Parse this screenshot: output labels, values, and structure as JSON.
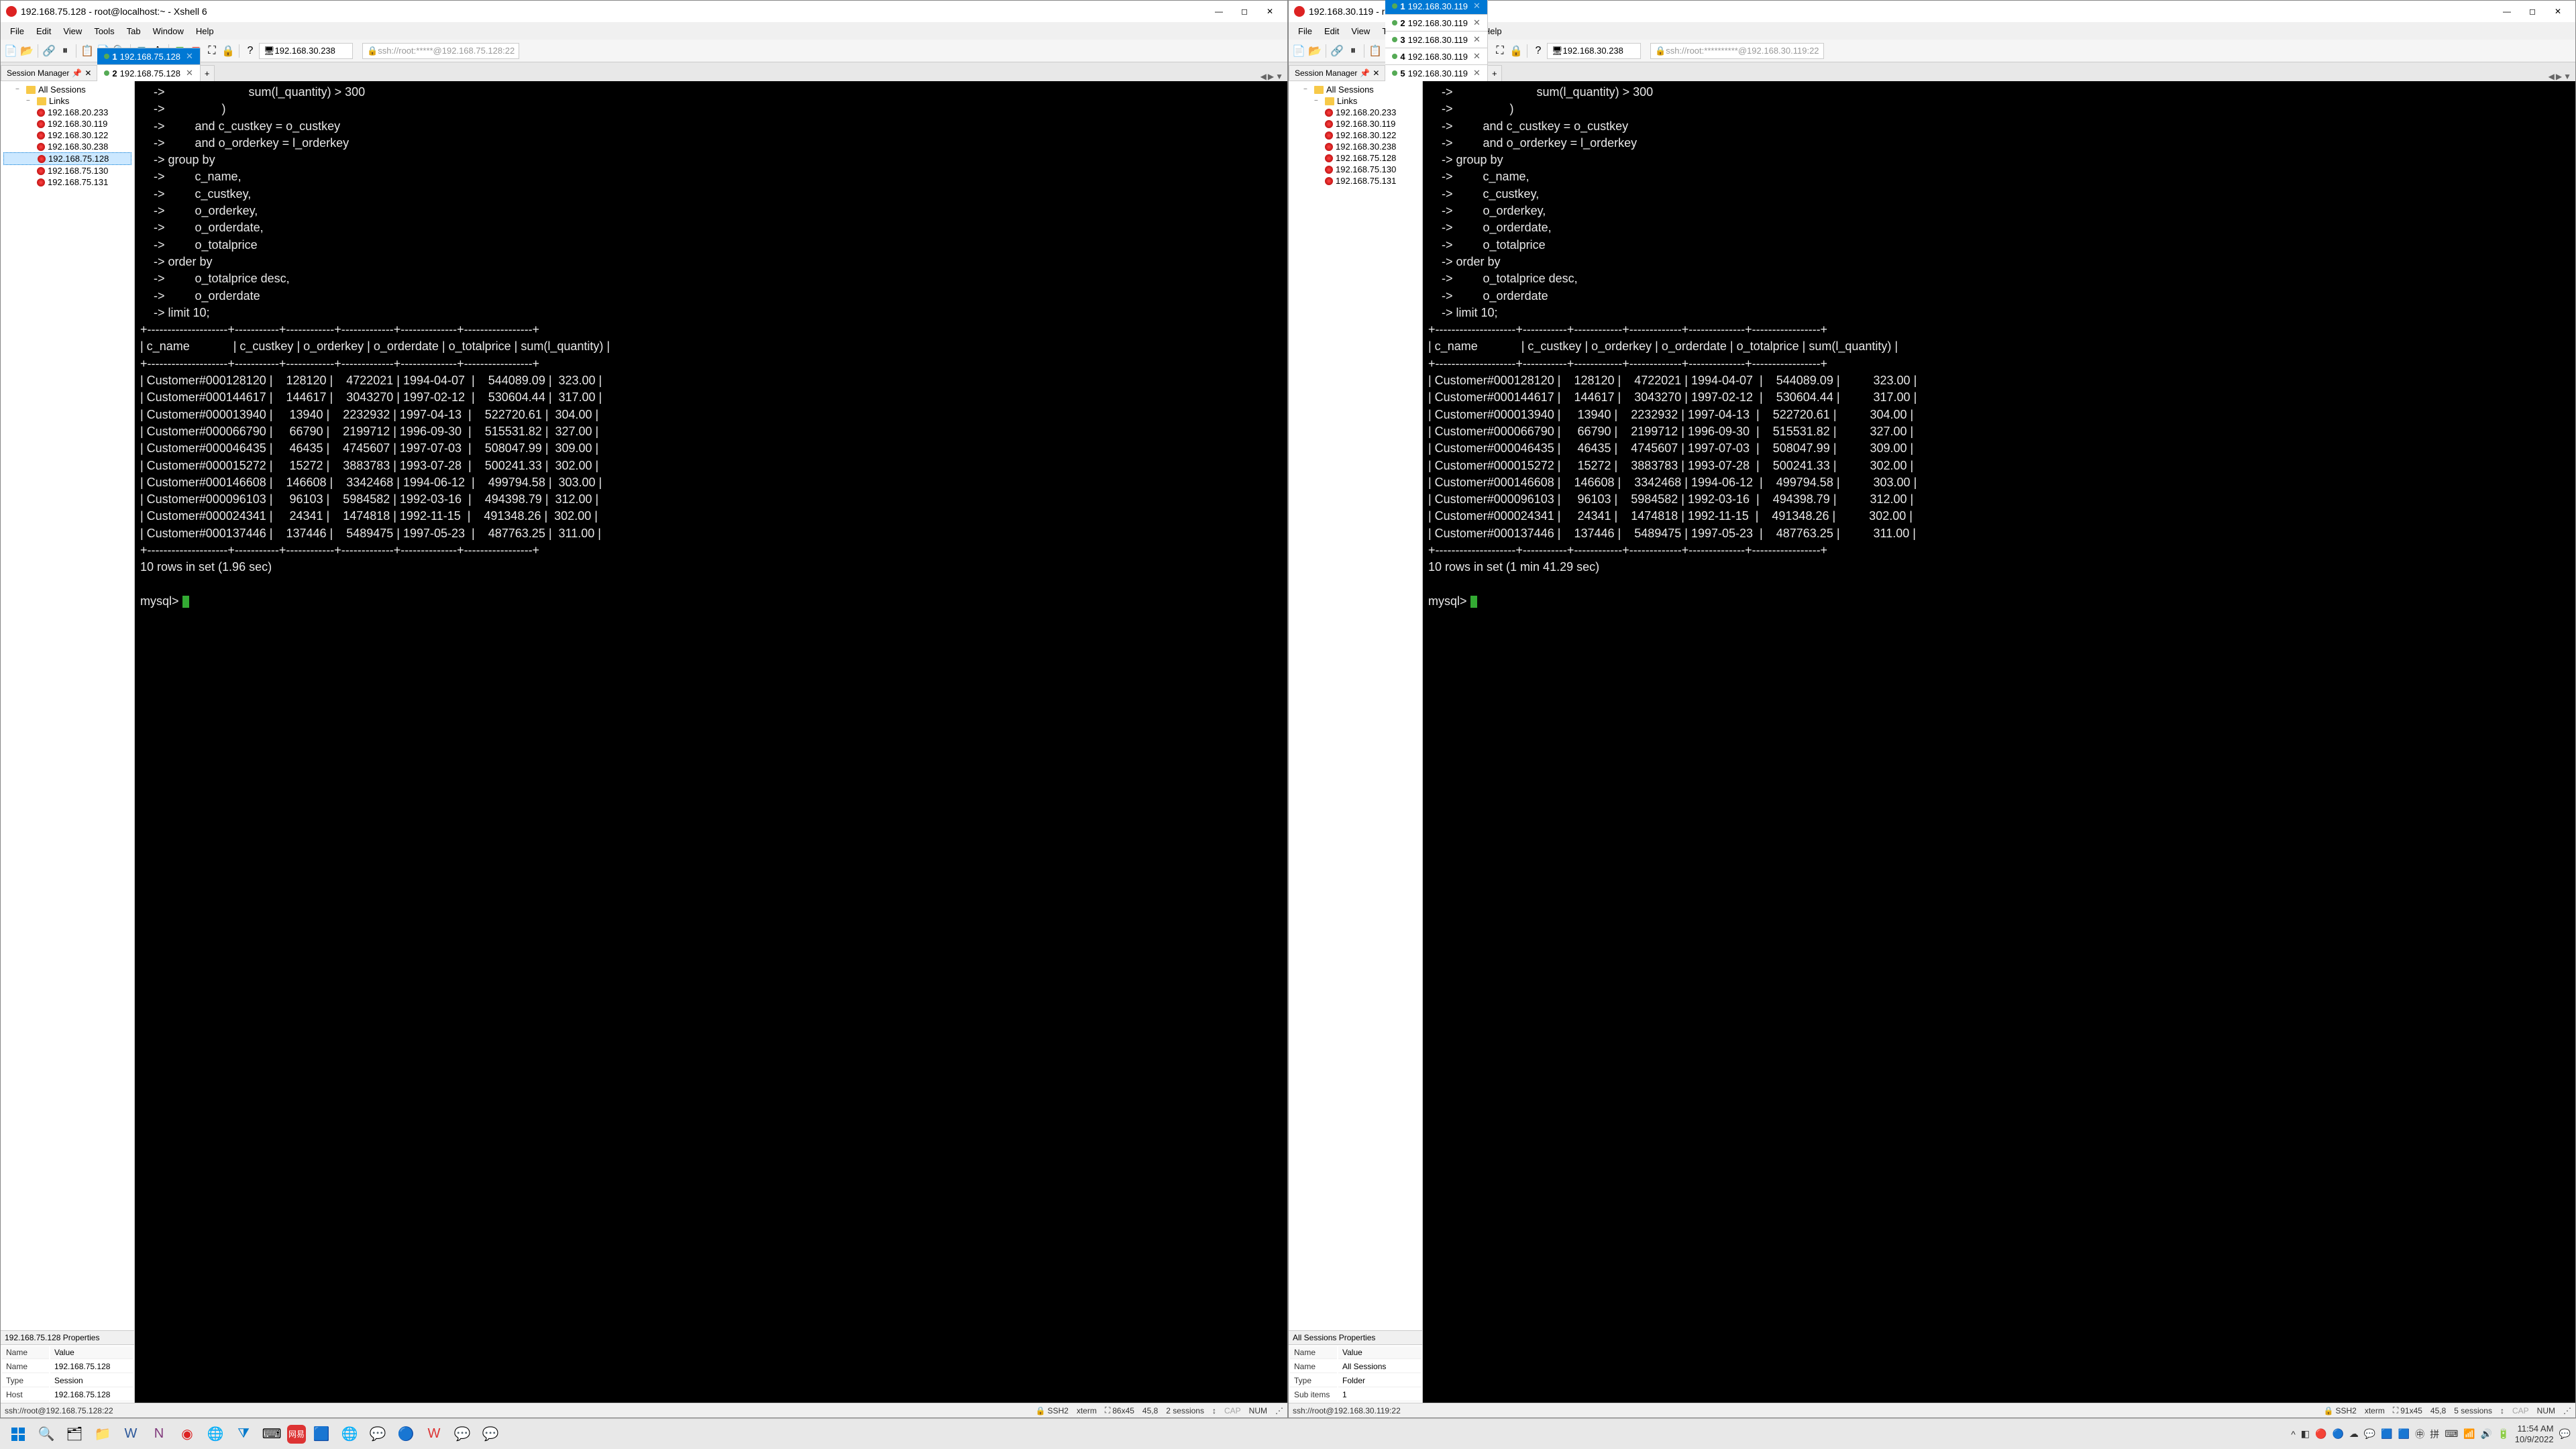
{
  "left": {
    "title": "192.168.75.128 - root@localhost:~ - Xshell 6",
    "menus": [
      "File",
      "Edit",
      "View",
      "Tools",
      "Tab",
      "Window",
      "Help"
    ],
    "addr1": "192.168.30.238",
    "addr2": "ssh://root:*****@192.168.75.128:22",
    "sessionMgr": "Session Manager",
    "tabs": [
      {
        "num": "1",
        "label": "192.168.75.128",
        "active": true
      },
      {
        "num": "2",
        "label": "192.168.75.128",
        "active": false
      }
    ],
    "tree": {
      "all": "All Sessions",
      "links": "Links",
      "servers": [
        "192.168.20.233",
        "192.168.30.119",
        "192.168.30.122",
        "192.168.30.238",
        "192.168.75.128",
        "192.168.75.130",
        "192.168.75.131"
      ],
      "selected": "192.168.75.128"
    },
    "propsTitle": "192.168.75.128 Properties",
    "props": [
      [
        "Name",
        "Value"
      ],
      [
        "Name",
        "192.168.75.128"
      ],
      [
        "Type",
        "Session"
      ],
      [
        "Host",
        "192.168.75.128"
      ]
    ],
    "term": "    ->                         sum(l_quantity) > 300\n    ->                 )\n    ->         and c_custkey = o_custkey\n    ->         and o_orderkey = l_orderkey\n    -> group by\n    ->         c_name,\n    ->         c_custkey,\n    ->         o_orderkey,\n    ->         o_orderdate,\n    ->         o_totalprice\n    -> order by\n    ->         o_totalprice desc,\n    ->         o_orderdate\n    -> limit 10;\n+--------------------+-----------+------------+-------------+--------------+-----------------+\n| c_name             | c_custkey | o_orderkey | o_orderdate | o_totalprice | sum(l_quantity) |\n+--------------------+-----------+------------+-------------+--------------+-----------------+\n| Customer#000128120 |    128120 |    4722021 | 1994-04-07  |    544089.09 |  323.00 |\n| Customer#000144617 |    144617 |    3043270 | 1997-02-12  |    530604.44 |  317.00 |\n| Customer#000013940 |     13940 |    2232932 | 1997-04-13  |    522720.61 |  304.00 |\n| Customer#000066790 |     66790 |    2199712 | 1996-09-30  |    515531.82 |  327.00 |\n| Customer#000046435 |     46435 |    4745607 | 1997-07-03  |    508047.99 |  309.00 |\n| Customer#000015272 |     15272 |    3883783 | 1993-07-28  |    500241.33 |  302.00 |\n| Customer#000146608 |    146608 |    3342468 | 1994-06-12  |    499794.58 |  303.00 |\n| Customer#000096103 |     96103 |    5984582 | 1992-03-16  |    494398.79 |  312.00 |\n| Customer#000024341 |     24341 |    1474818 | 1992-11-15  |    491348.26 |  302.00 |\n| Customer#000137446 |    137446 |    5489475 | 1997-05-23  |    487763.25 |  311.00 |\n+--------------------+-----------+------------+-------------+--------------+-----------------+\n10 rows in set (1.96 sec)\n\nmysql> ",
    "status": {
      "conn": "ssh://root@192.168.75.128:22",
      "ssh": "SSH2",
      "term": "xterm",
      "size": "86x45",
      "pos": "45,8",
      "sessions": "2 sessions",
      "cap": "CAP",
      "num": "NUM"
    }
  },
  "right": {
    "title": "192.168.30.119 - root@htap:~ - Xshell 6",
    "menus": [
      "File",
      "Edit",
      "View",
      "Tools",
      "Tab",
      "Window",
      "Help"
    ],
    "addr1": "192.168.30.238",
    "addr2": "ssh://root:**********@192.168.30.119:22",
    "sessionMgr": "Session Manager",
    "tabs": [
      {
        "num": "1",
        "label": "192.168.30.119",
        "active": true
      },
      {
        "num": "2",
        "label": "192.168.30.119",
        "active": false
      },
      {
        "num": "3",
        "label": "192.168.30.119",
        "active": false
      },
      {
        "num": "4",
        "label": "192.168.30.119",
        "active": false
      },
      {
        "num": "5",
        "label": "192.168.30.119",
        "active": false
      }
    ],
    "tree": {
      "all": "All Sessions",
      "links": "Links",
      "servers": [
        "192.168.20.233",
        "192.168.30.119",
        "192.168.30.122",
        "192.168.30.238",
        "192.168.75.128",
        "192.168.75.130",
        "192.168.75.131"
      ],
      "selected": ""
    },
    "propsTitle": "All Sessions Properties",
    "props": [
      [
        "Name",
        "Value"
      ],
      [
        "Name",
        "All Sessions"
      ],
      [
        "Type",
        "Folder"
      ],
      [
        "Sub items",
        "1"
      ]
    ],
    "term": "    ->                         sum(l_quantity) > 300\n    ->                 )\n    ->         and c_custkey = o_custkey\n    ->         and o_orderkey = l_orderkey\n    -> group by\n    ->         c_name,\n    ->         c_custkey,\n    ->         o_orderkey,\n    ->         o_orderdate,\n    ->         o_totalprice\n    -> order by\n    ->         o_totalprice desc,\n    ->         o_orderdate\n    -> limit 10;\n+--------------------+-----------+------------+-------------+--------------+-----------------+\n| c_name             | c_custkey | o_orderkey | o_orderdate | o_totalprice | sum(l_quantity) |\n+--------------------+-----------+------------+-------------+--------------+-----------------+\n| Customer#000128120 |    128120 |    4722021 | 1994-04-07  |    544089.09 |          323.00 |\n| Customer#000144617 |    144617 |    3043270 | 1997-02-12  |    530604.44 |          317.00 |\n| Customer#000013940 |     13940 |    2232932 | 1997-04-13  |    522720.61 |          304.00 |\n| Customer#000066790 |     66790 |    2199712 | 1996-09-30  |    515531.82 |          327.00 |\n| Customer#000046435 |     46435 |    4745607 | 1997-07-03  |    508047.99 |          309.00 |\n| Customer#000015272 |     15272 |    3883783 | 1993-07-28  |    500241.33 |          302.00 |\n| Customer#000146608 |    146608 |    3342468 | 1994-06-12  |    499794.58 |          303.00 |\n| Customer#000096103 |     96103 |    5984582 | 1992-03-16  |    494398.79 |          312.00 |\n| Customer#000024341 |     24341 |    1474818 | 1992-11-15  |    491348.26 |          302.00 |\n| Customer#000137446 |    137446 |    5489475 | 1997-05-23  |    487763.25 |          311.00 |\n+--------------------+-----------+------------+-------------+--------------+-----------------+\n10 rows in set (1 min 41.29 sec)\n\nmysql> ",
    "status": {
      "conn": "ssh://root@192.168.30.119:22",
      "ssh": "SSH2",
      "term": "xterm",
      "size": "91x45",
      "pos": "45,8",
      "sessions": "5 sessions",
      "cap": "CAP",
      "num": "NUM"
    }
  },
  "taskbar": {
    "time": "11:54 AM",
    "date": "10/9/2022",
    "ime": "拼"
  }
}
